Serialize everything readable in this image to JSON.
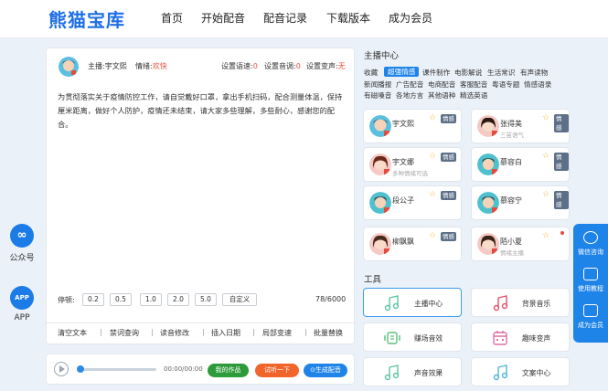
{
  "header": {
    "logo": "熊猫宝库",
    "nav": [
      "首页",
      "开始配音",
      "配音记录",
      "下载版本",
      "成为会员"
    ]
  },
  "side": {
    "wechat": "公众号",
    "app": "APP",
    "app_badge": "APP"
  },
  "editor": {
    "anchor_label": "主播:宇文熙",
    "emotion_label": "情绪:",
    "emotion_value": "欢快",
    "speed_label": "设置语速:",
    "speed_value": "0",
    "pitch_label": "设置音调:",
    "pitch_value": "0",
    "voice_change_label": "设置变声:",
    "voice_change_value": "无",
    "text": "为贯彻落实关于疫情防控工作，请自觉戴好口罩，拿出手机扫码，配合测量体温，保持厘米距离，做好个人防护，疫情还未结束，请大家多些理解，多些耐心，感谢您的配合。",
    "pause_label": "停顿:",
    "pause_options": [
      "0.2",
      "0.5",
      "1.0",
      "2.0",
      "5.0",
      "自定义"
    ],
    "counter": "78/6000",
    "toolbar": [
      "清空文本",
      "禁词查询",
      "读音修改",
      "插入日期",
      "局部变速",
      "批量替换"
    ]
  },
  "player": {
    "time": "00:00/00:00",
    "my_works": "我的作品",
    "try_listen": "试听一下",
    "generate": "生成配音"
  },
  "anchor_center": {
    "title": "主播中心",
    "categories_row1": [
      "收藏",
      "超强情感",
      "课件制作",
      "电影解说",
      "生活常识",
      "有声读物"
    ],
    "categories_row2": [
      "新闻播报",
      "广告配音",
      "电商配音",
      "客服配音",
      "粤语专题",
      "情感语录"
    ],
    "categories_row3": [
      "有磁嗓音",
      "各地方言",
      "其他语种",
      "精选英语"
    ],
    "active_category": "超强情感",
    "anchors": [
      {
        "name": "宇文熙",
        "sub": "",
        "tag": "情感"
      },
      {
        "name": "张得美",
        "sub": "三苗语气",
        "tag": "情感"
      },
      {
        "name": "宇文娜",
        "sub": "多种情绪可选",
        "tag": "情感"
      },
      {
        "name": "慕容白",
        "sub": "",
        "tag": "情感"
      },
      {
        "name": "段公子",
        "sub": "",
        "tag": "情感"
      },
      {
        "name": "慕容宁",
        "sub": "",
        "tag": "情感"
      },
      {
        "name": "柳飘飘",
        "sub": "",
        "tag": "情感"
      },
      {
        "name": "陌小夏",
        "sub": "情绪主播",
        "tag": "情感"
      }
    ]
  },
  "tools": {
    "title": "工具",
    "items": [
      "主播中心",
      "背景音乐",
      "赚场音效",
      "趣味变声",
      "声音效果",
      "文案中心"
    ]
  },
  "right_bar": [
    "微信咨询",
    "使用教程",
    "成为会员"
  ],
  "colors": {
    "accent": "#1f84e8",
    "logo": "#1f6fe6",
    "red": "#e94e3c",
    "green": "#2e9b3a",
    "orange": "#f1652a"
  }
}
